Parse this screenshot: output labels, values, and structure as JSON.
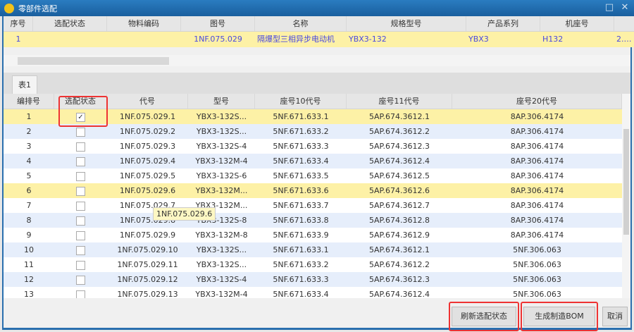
{
  "window": {
    "title": "零部件选配",
    "maximize": "□",
    "close": "✕"
  },
  "top_table": {
    "headers": [
      "序号",
      "选配状态",
      "物料编码",
      "图号",
      "名称",
      "规格型号",
      "产品系列",
      "机座号",
      ""
    ],
    "rows": [
      [
        "1",
        "",
        "",
        "1NF.075.029",
        "隔爆型三相异步电动机",
        "YBX3-132",
        "YBX3",
        "H132",
        "2.2..."
      ]
    ]
  },
  "tab": "表1",
  "grid": {
    "headers": [
      "编排号",
      "选配状态",
      "代号",
      "型号",
      "座号10代号",
      "座号11代号",
      "座号20代号"
    ],
    "rows": [
      {
        "no": "1",
        "checked": true,
        "code": "1NF.075.029.1",
        "model": "YBX3-132S...",
        "c10": "5NF.671.633.1",
        "c11": "5AP.674.3612.1",
        "c20": "8AP.306.4174"
      },
      {
        "no": "2",
        "checked": false,
        "code": "1NF.075.029.2",
        "model": "YBX3-132S...",
        "c10": "5NF.671.633.2",
        "c11": "5AP.674.3612.2",
        "c20": "8AP.306.4174"
      },
      {
        "no": "3",
        "checked": false,
        "code": "1NF.075.029.3",
        "model": "YBX3-132S-4",
        "c10": "5NF.671.633.3",
        "c11": "5AP.674.3612.3",
        "c20": "8AP.306.4174"
      },
      {
        "no": "4",
        "checked": false,
        "code": "1NF.075.029.4",
        "model": "YBX3-132M-4",
        "c10": "5NF.671.633.4",
        "c11": "5AP.674.3612.4",
        "c20": "8AP.306.4174"
      },
      {
        "no": "5",
        "checked": false,
        "code": "1NF.075.029.5",
        "model": "YBX3-132S-6",
        "c10": "5NF.671.633.5",
        "c11": "5AP.674.3612.5",
        "c20": "8AP.306.4174"
      },
      {
        "no": "6",
        "checked": false,
        "code": "1NF.075.029.6",
        "model": "YBX3-132M...",
        "c10": "5NF.671.633.6",
        "c11": "5AP.674.3612.6",
        "c20": "8AP.306.4174"
      },
      {
        "no": "7",
        "checked": false,
        "code": "1NF.075.029.7",
        "model": "YBX3-132M...",
        "c10": "5NF.671.633.7",
        "c11": "5AP.674.3612.7",
        "c20": "8AP.306.4174"
      },
      {
        "no": "8",
        "checked": false,
        "code": "1NF.075.029.8",
        "model": "YBX3-132S-8",
        "c10": "5NF.671.633.8",
        "c11": "5AP.674.3612.8",
        "c20": "8AP.306.4174"
      },
      {
        "no": "9",
        "checked": false,
        "code": "1NF.075.029.9",
        "model": "YBX3-132M-8",
        "c10": "5NF.671.633.9",
        "c11": "5AP.674.3612.9",
        "c20": "8AP.306.4174"
      },
      {
        "no": "10",
        "checked": false,
        "code": "1NF.075.029.10",
        "model": "YBX3-132S...",
        "c10": "5NF.671.633.1",
        "c11": "5AP.674.3612.1",
        "c20": "5NF.306.063"
      },
      {
        "no": "11",
        "checked": false,
        "code": "1NF.075.029.11",
        "model": "YBX3-132S...",
        "c10": "5NF.671.633.2",
        "c11": "5AP.674.3612.2",
        "c20": "5NF.306.063"
      },
      {
        "no": "12",
        "checked": false,
        "code": "1NF.075.029.12",
        "model": "YBX3-132S-4",
        "c10": "5NF.671.633.3",
        "c11": "5AP.674.3612.3",
        "c20": "5NF.306.063"
      },
      {
        "no": "13",
        "checked": false,
        "code": "1NF.075.029.13",
        "model": "YBX3-132M-4",
        "c10": "5NF.671.633.4",
        "c11": "5AP.674.3612.4",
        "c20": "5NF.306.063"
      }
    ]
  },
  "tooltip": "1NF.075.029.6",
  "buttons": {
    "refresh": "刷新选配状态",
    "generate": "生成制造BOM",
    "cancel": "取消"
  }
}
